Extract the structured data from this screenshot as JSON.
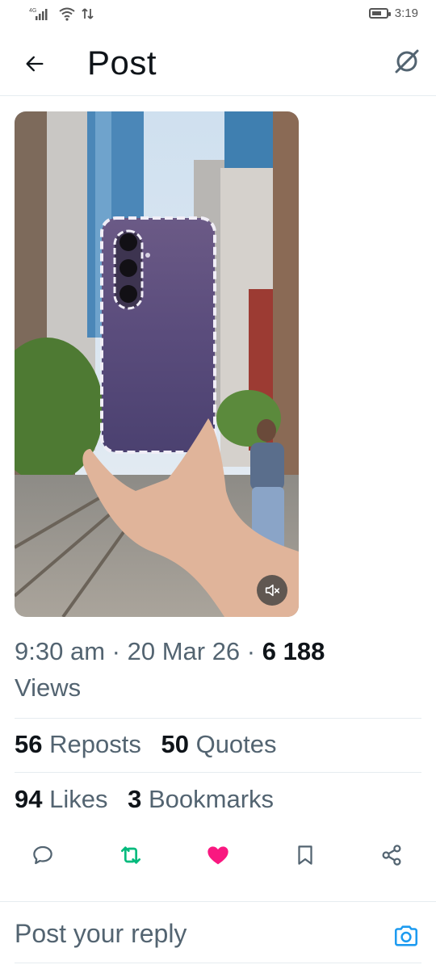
{
  "status_bar": {
    "network": "4G",
    "time": "3:19",
    "battery_level": 0.7
  },
  "header": {
    "title": "Post",
    "back_icon": "arrow-left-icon",
    "grok_icon": "grok-icon"
  },
  "media": {
    "description_icon": "video-thumbnail",
    "mute_icon": "speaker-muted-icon"
  },
  "meta": {
    "time": "9:30 am",
    "dot1": "·",
    "date": "20 Mar 26",
    "dot2": "·",
    "views_count": "6 188",
    "views_label": "Views"
  },
  "stats": {
    "reposts_count": "56",
    "reposts_label": "Reposts",
    "quotes_count": "50",
    "quotes_label": "Quotes",
    "likes_count": "94",
    "likes_label": "Likes",
    "bookmarks_count": "3",
    "bookmarks_label": "Bookmarks"
  },
  "actions": {
    "reply_icon": "reply-icon",
    "repost_icon": "repost-icon",
    "like_icon": "heart-icon",
    "bookmark_icon": "bookmark-icon",
    "share_icon": "share-icon",
    "repost_color": "#00ba7c",
    "like_color": "#f91880",
    "neutral_color": "#536471"
  },
  "reply": {
    "placeholder": "Post your reply",
    "camera_icon": "camera-icon",
    "accent": "#1d9bf0"
  }
}
